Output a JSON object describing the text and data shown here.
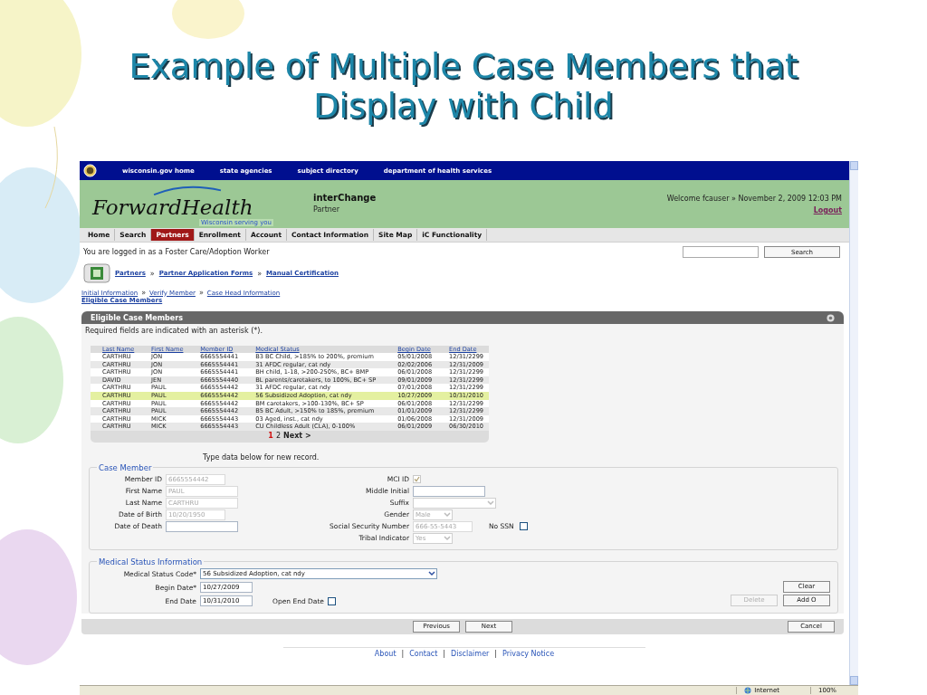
{
  "slide_title": [
    "Example of Multiple Case Members that",
    "Display with Child"
  ],
  "top_links": [
    "wisconsin.gov home",
    "state agencies",
    "subject directory",
    "department of health services"
  ],
  "header": {
    "logo": "ForwardHealth",
    "tagline": "Wisconsin serving you",
    "app": "interChange",
    "role": "Partner",
    "welcome": "Welcome fcauser » November 2, 2009 12:03 PM",
    "logout": "Logout"
  },
  "nav_tabs": [
    {
      "label": "Home",
      "selected": false
    },
    {
      "label": "Search",
      "selected": false
    },
    {
      "label": "Partners",
      "selected": true
    },
    {
      "label": "Enrollment",
      "selected": false
    },
    {
      "label": "Account",
      "selected": false
    },
    {
      "label": "Contact Information",
      "selected": false
    },
    {
      "label": "Site Map",
      "selected": false
    },
    {
      "label": "iC Functionality",
      "selected": false
    }
  ],
  "logged_in": "You are logged in as a Foster Care/Adoption Worker",
  "search_button": "Search",
  "crumb_separator": "»",
  "breadcrumb": [
    "Partners",
    "Partner Application Forms",
    "Manual Certification"
  ],
  "sub_breadcrumb": [
    "Initial Information",
    "Verify Member",
    "Case Head Information"
  ],
  "current_step": "Eligible Case Members",
  "panel": {
    "title": "Eligible Case Members",
    "note": "Required fields are indicated with an asterisk (*)."
  },
  "table": {
    "columns": [
      "Last Name",
      "First Name",
      "Member ID",
      "Medical Status",
      "Begin Date",
      "End Date"
    ],
    "rows": [
      {
        "cells": [
          "CARTHRU",
          "JON",
          "6665554441",
          "B3 BC Child, >185% to 200%, premium",
          "05/01/2008",
          "12/31/2299"
        ],
        "selected": false
      },
      {
        "cells": [
          "CARTHRU",
          "JON",
          "6665554441",
          "31 AFDC regular, cat ndy",
          "02/02/2006",
          "12/31/2009"
        ],
        "selected": false
      },
      {
        "cells": [
          "CARTHRU",
          "JON",
          "6665554441",
          "BH child, 1-18, >200-250%, BC+ BMP",
          "06/01/2008",
          "12/31/2299"
        ],
        "selected": false
      },
      {
        "cells": [
          "DAVID",
          "JEN",
          "6665554440",
          "BL parents/caretakers, to 100%, BC+ SP",
          "09/01/2009",
          "12/31/2299"
        ],
        "selected": false
      },
      {
        "cells": [
          "CARTHRU",
          "PAUL",
          "6665554442",
          "31 AFDC regular, cat ndy",
          "07/01/2008",
          "12/31/2299"
        ],
        "selected": false
      },
      {
        "cells": [
          "CARTHRU",
          "PAUL",
          "6665554442",
          "56 Subsidized Adoption, cat ndy",
          "10/27/2009",
          "10/31/2010"
        ],
        "selected": true
      },
      {
        "cells": [
          "CARTHRU",
          "PAUL",
          "6665554442",
          "BM caretakers, >100-130%, BC+ SP",
          "06/01/2008",
          "12/31/2299"
        ],
        "selected": false
      },
      {
        "cells": [
          "CARTHRU",
          "PAUL",
          "6665554442",
          "B5 BC Adult, >150% to 185%, premium",
          "01/01/2009",
          "12/31/2299"
        ],
        "selected": false
      },
      {
        "cells": [
          "CARTHRU",
          "MICK",
          "6665554443",
          "03 Aged, inst., cat ndy",
          "01/06/2008",
          "12/31/2009"
        ],
        "selected": false
      },
      {
        "cells": [
          "CARTHRU",
          "MICK",
          "6665554443",
          "CU Childless Adult (CLA), 0-100%",
          "06/01/2009",
          "06/30/2010"
        ],
        "selected": false
      }
    ],
    "pages": [
      {
        "label": "1",
        "selected": true
      },
      {
        "label": "2",
        "selected": false
      }
    ],
    "next": "Next >"
  },
  "instruction": "Type data below for new record.",
  "case_member": {
    "legend": "Case Member",
    "left_fields": [
      {
        "label": "Member ID",
        "kind": "text",
        "value": "6665554442",
        "disabled": true
      },
      {
        "label": "First Name",
        "kind": "text",
        "value": "PAUL",
        "disabled": true
      },
      {
        "label": "Last Name",
        "kind": "text",
        "value": "CARTHRU",
        "disabled": true
      },
      {
        "label": "Date of Birth",
        "kind": "text",
        "value": "10/20/1950",
        "disabled": true
      },
      {
        "label": "Date of Death",
        "kind": "text",
        "disabled": false
      }
    ],
    "right_fields": [
      {
        "label": "MCI ID",
        "kind": "checkbox",
        "checked": true,
        "disabled": true
      },
      {
        "label": "Middle Initial",
        "kind": "text",
        "disabled": false
      },
      {
        "label": "Suffix",
        "kind": "select",
        "disabled": true
      },
      {
        "label": "Gender",
        "kind": "select",
        "value": "Male",
        "disabled": true
      },
      {
        "label": "Social Security Number",
        "kind": "text",
        "value": "666-55-5443",
        "disabled": true,
        "extra": {
          "label": "No SSN",
          "checked": false
        }
      },
      {
        "label": "Tribal Indicator",
        "kind": "select",
        "value": "Yes",
        "disabled": true
      }
    ]
  },
  "medical_status": {
    "legend": "Medical Status Information",
    "code_label": "Medical Status Code*",
    "code_value": "56 Subsidized Adoption, cat ndy",
    "begin_label": "Begin Date*",
    "begin_value": "10/27/2009",
    "end_label": "End Date",
    "end_value": "10/31/2010",
    "open_end_label": "Open End Date",
    "open_end_checked": false,
    "buttons": [
      {
        "label": "Clear",
        "disabled": false
      },
      {
        "label": "Delete",
        "disabled": true
      },
      {
        "label": "Add O",
        "disabled": false
      }
    ]
  },
  "nav_buttons": [
    "Previous",
    "Next",
    "Cancel"
  ],
  "footer_separator": "|",
  "footer_links": [
    "About",
    "Contact",
    "Disclaimer",
    "Privacy Notice"
  ],
  "status_bar": {
    "zone": "Internet",
    "zoom": "100%"
  }
}
